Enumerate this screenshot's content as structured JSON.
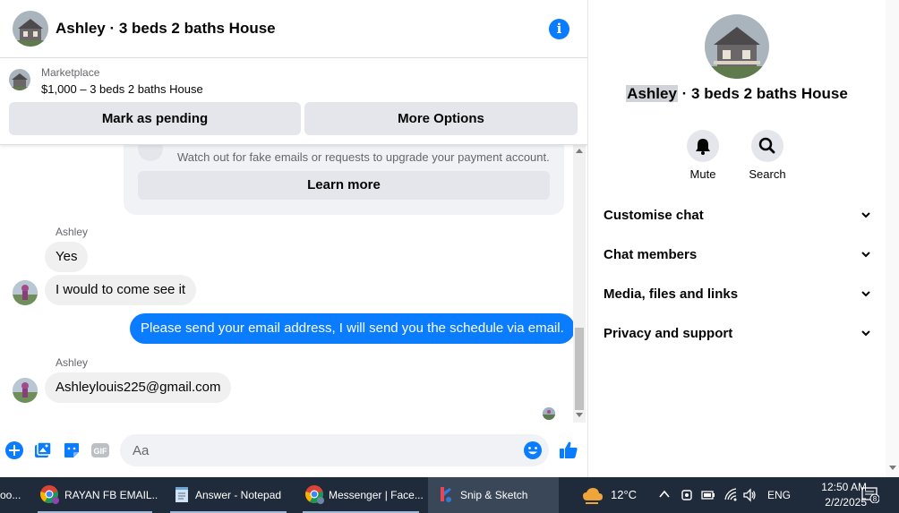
{
  "header": {
    "title": "Ashley · 3 beds 2 baths House",
    "info_icon": "info-icon"
  },
  "marketplace": {
    "label": "Marketplace",
    "listing": "$1,000 – 3 beds 2 baths House",
    "pending_button": "Mark as pending",
    "more_button": "More Options"
  },
  "safety_card": {
    "text": "Watch out for fake emails or requests to upgrade your payment account.",
    "learn_more": "Learn more"
  },
  "messages": [
    {
      "sender": "Ashley",
      "text": "Yes",
      "direction": "incoming"
    },
    {
      "text": "I would to come see it",
      "direction": "incoming"
    },
    {
      "text": "Please send your email address, I will send you the schedule via email.",
      "direction": "outgoing"
    },
    {
      "sender": "Ashley",
      "text": "Ashleylouis225@gmail.com",
      "direction": "incoming"
    }
  ],
  "composer": {
    "placeholder": "Aa",
    "icons": [
      "plus-icon",
      "photo-icon",
      "sticker-icon",
      "gif-icon",
      "emoji-icon",
      "like-icon"
    ],
    "gif_label": "GIF"
  },
  "panel": {
    "name_highlight": "Ashley",
    "title_rest": " · 3 beds 2 baths House",
    "actions": [
      {
        "label": "Mute",
        "icon": "bell-icon"
      },
      {
        "label": "Search",
        "icon": "search-icon"
      }
    ],
    "sections": [
      "Customise chat",
      "Chat members",
      "Media, files and links",
      "Privacy and support"
    ]
  },
  "taskbar": {
    "apps": [
      {
        "label": "oo...",
        "icon": "app-icon"
      },
      {
        "label": "RAYAN FB EMAIL...",
        "icon": "chrome-icon"
      },
      {
        "label": "Answer - Notepad",
        "icon": "notepad-icon"
      },
      {
        "label": "Messenger | Face...",
        "icon": "chrome-icon"
      },
      {
        "label": "Snip & Sketch",
        "icon": "snip-icon",
        "active": true
      }
    ],
    "weather": "12°C",
    "language": "ENG",
    "time": "12:50 AM",
    "date": "2/2/2025",
    "notification_count": "8"
  },
  "colors": {
    "accent": "#0a7cff",
    "bubble_in": "#f0f0f0",
    "button_bg": "#e4e6eb",
    "taskbar": "#1f2a3a"
  }
}
